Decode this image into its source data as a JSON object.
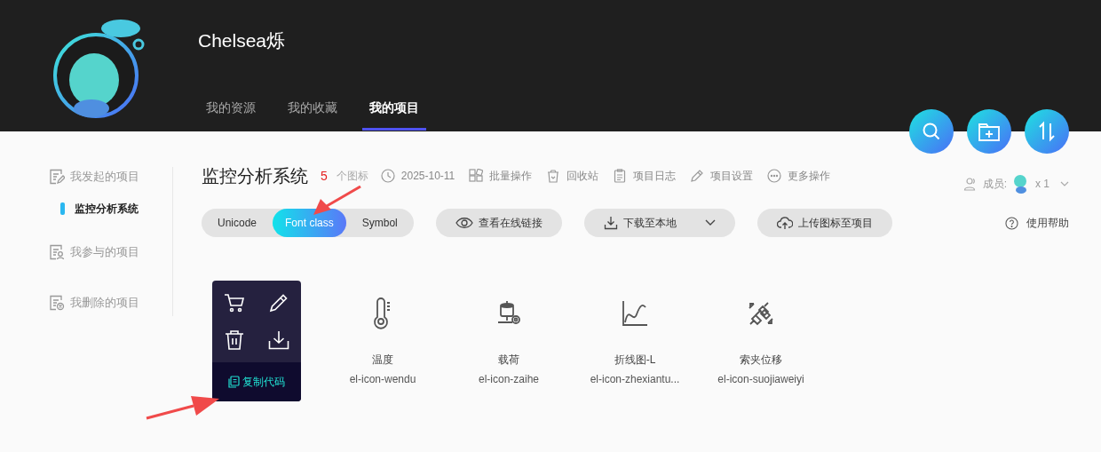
{
  "user": {
    "name": "Chelsea烁"
  },
  "nav_tabs": [
    {
      "label": "我的资源",
      "selected": false
    },
    {
      "label": "我的收藏",
      "selected": false
    },
    {
      "label": "我的项目",
      "selected": true
    }
  ],
  "sidebar": {
    "items": [
      {
        "kind": "group",
        "label": "我发起的项目"
      },
      {
        "kind": "project",
        "label": "监控分析系统",
        "selected": true
      },
      {
        "kind": "group",
        "label": "我参与的项目"
      },
      {
        "kind": "group",
        "label": "我删除的项目"
      }
    ]
  },
  "project": {
    "title": "监控分析系统",
    "count": "5",
    "count_label": "个图标",
    "meta": [
      {
        "label": "2025-10-11"
      },
      {
        "label": "批量操作"
      },
      {
        "label": "回收站"
      },
      {
        "label": "项目日志"
      },
      {
        "label": "项目设置"
      },
      {
        "label": "更多操作"
      }
    ],
    "members": {
      "label": "成员:",
      "count": "x 1"
    }
  },
  "format_tabs": [
    {
      "label": "Unicode",
      "selected": false
    },
    {
      "label": "Font class",
      "selected": true
    },
    {
      "label": "Symbol",
      "selected": false
    }
  ],
  "buttons": [
    {
      "kind": "view",
      "label": "查看在线链接"
    },
    {
      "kind": "download",
      "label": "下载至本地"
    },
    {
      "kind": "upload",
      "label": "上传图标至项目"
    }
  ],
  "help": "使用帮助",
  "icons": [
    {
      "kind": "hover",
      "copy_label": "复制代码"
    },
    {
      "kind": "icon",
      "name": "温度",
      "code": "el-icon-wendu"
    },
    {
      "kind": "icon",
      "name": "载荷",
      "code": "el-icon-zaihe"
    },
    {
      "kind": "icon",
      "name": "折线图-L",
      "code": "el-icon-zhexiantu..."
    },
    {
      "kind": "icon",
      "name": "索夹位移",
      "code": "el-icon-suojiaweiyi"
    }
  ]
}
